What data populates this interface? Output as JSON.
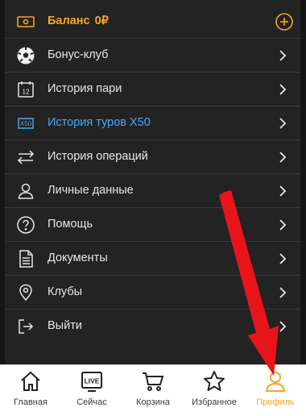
{
  "menu": {
    "balance": {
      "label": "Баланс",
      "amount": "0₽"
    },
    "items": [
      {
        "label": "Бонус-клуб",
        "icon": "soccer-ball-icon"
      },
      {
        "label": "История пари",
        "icon": "calendar-12-icon"
      },
      {
        "label": "История туров X50",
        "icon": "x50-icon",
        "highlight": "#47a9f0"
      },
      {
        "label": "История операций",
        "icon": "transfer-arrows-icon"
      },
      {
        "label": "Личные данные",
        "icon": "user-icon"
      },
      {
        "label": "Помощь",
        "icon": "question-circle-icon"
      },
      {
        "label": "Документы",
        "icon": "document-icon"
      },
      {
        "label": "Клубы",
        "icon": "location-pin-icon"
      },
      {
        "label": "Выйти",
        "icon": "logout-icon"
      }
    ]
  },
  "tabbar": {
    "tabs": [
      {
        "label": "Главная",
        "icon": "home-icon"
      },
      {
        "label": "Сейчас",
        "icon": "live-icon",
        "icon_text": "LIVE"
      },
      {
        "label": "Корзина",
        "icon": "cart-icon"
      },
      {
        "label": "Избранное",
        "icon": "star-icon"
      },
      {
        "label": "Профиль",
        "icon": "profile-icon",
        "active": true
      }
    ]
  },
  "colors": {
    "accent": "#f5a623",
    "highlight": "#47a9f0",
    "background": "#232323",
    "annotation_arrow": "#e8141b"
  }
}
